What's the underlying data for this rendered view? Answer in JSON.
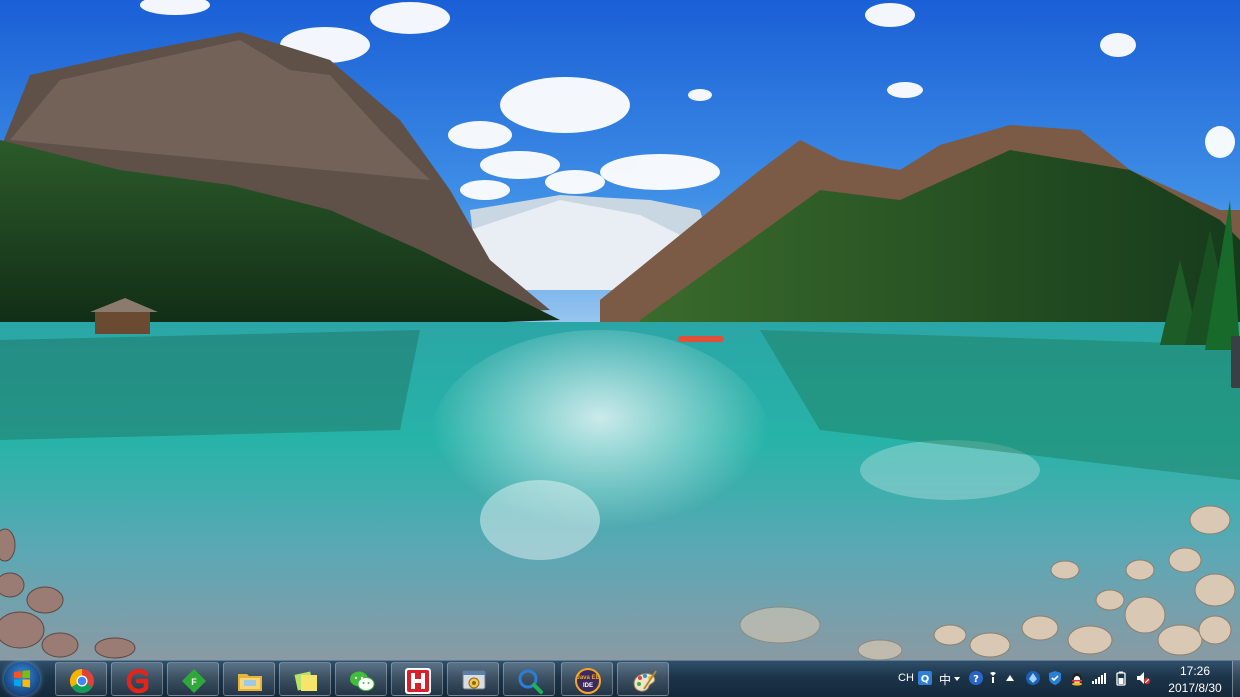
{
  "desktop": {
    "wallpaper": "lake-mountains-landscape"
  },
  "taskbar": {
    "start_button": {
      "icon": "windows-logo"
    },
    "apps": [
      {
        "name": "chrome",
        "icon": "chrome-icon"
      },
      {
        "name": "app-g",
        "icon": "g-logo-icon"
      },
      {
        "name": "app-f",
        "icon": "green-diamond-icon"
      },
      {
        "name": "explorer",
        "icon": "folder-icon"
      },
      {
        "name": "sticky-notes",
        "icon": "sticky-notes-icon"
      },
      {
        "name": "wechat",
        "icon": "wechat-icon"
      },
      {
        "name": "app-h",
        "icon": "h-logo-icon"
      },
      {
        "name": "control-panel",
        "icon": "control-panel-icon"
      },
      {
        "name": "search-tool",
        "icon": "magnifier-icon"
      },
      {
        "name": "java-ee-ide",
        "icon": "java-ee-ide-icon",
        "label": "Java EE IDE"
      },
      {
        "name": "paint",
        "icon": "paint-icon"
      }
    ],
    "tray": {
      "language": "CH",
      "ime_char": "中",
      "clock_time": "17:26",
      "clock_date": "2017/8/30"
    }
  },
  "colors": {
    "taskbar": "#1c3449",
    "lake": "#2fbab0",
    "sky": "#1d63d8"
  }
}
